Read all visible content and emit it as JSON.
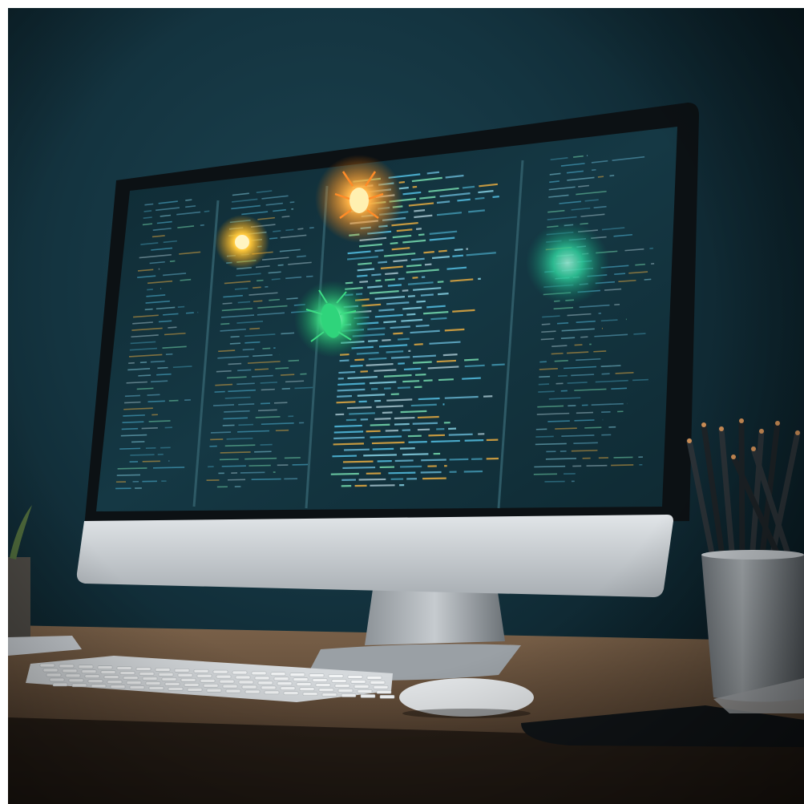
{
  "scene": {
    "description_kind": "photo",
    "colors": {
      "wall": "#143440",
      "desk": "#6a5440",
      "bezel": "#0c1114",
      "screen": "#12323d",
      "chin": "#c9ced2",
      "glow_orange": "#ffb347",
      "glow_green": "#3ddc84"
    },
    "icons": [
      "bug-glow-orange",
      "bug-glow-yellow",
      "bug-glow-green",
      "bug-glow-teal"
    ]
  }
}
